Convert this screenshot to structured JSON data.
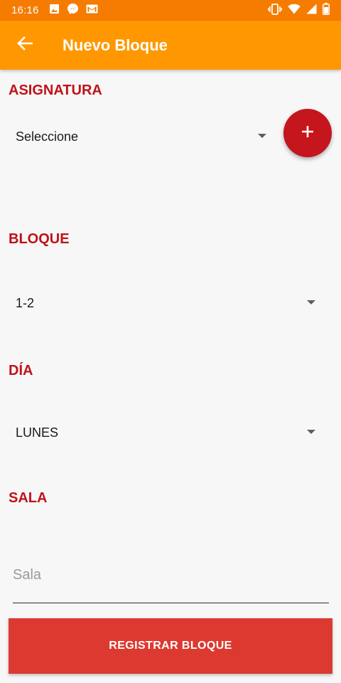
{
  "status_bar": {
    "time": "16:16",
    "left_icons": [
      "image-icon",
      "messenger-icon",
      "gmail-icon"
    ],
    "right_icons": [
      "vibrate-icon",
      "wifi-icon",
      "signal-icon",
      "battery-icon"
    ]
  },
  "app_bar": {
    "title": "Nuevo Bloque",
    "back_icon": "arrow-back-icon"
  },
  "form": {
    "asignatura": {
      "label": "ASIGNATURA",
      "selected": "Seleccione"
    },
    "bloque": {
      "label": "BLOQUE",
      "selected": "1-2"
    },
    "dia": {
      "label": "DÍA",
      "selected": "LUNES"
    },
    "sala": {
      "label": "SALA",
      "placeholder": "Sala",
      "value": ""
    }
  },
  "fab": {
    "icon": "plus-icon"
  },
  "submit_label": "REGISTRAR BLOQUE",
  "colors": {
    "status_bar": "#f57c00",
    "app_bar": "#ff9800",
    "label_red": "#c0121a",
    "fab_red": "#c4161c",
    "button_red": "#dc3a30"
  }
}
